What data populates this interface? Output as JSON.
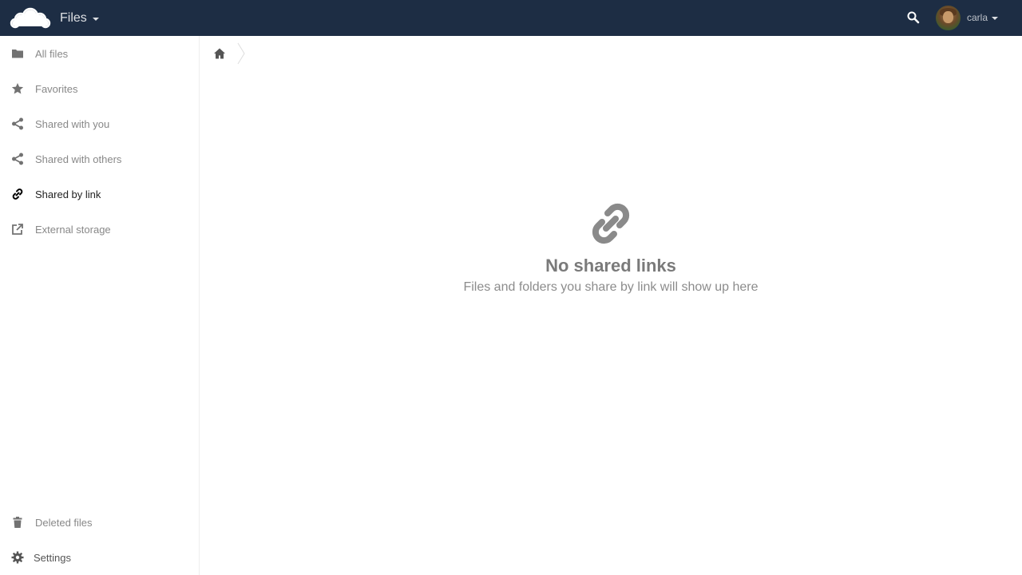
{
  "header": {
    "app_name": "Files",
    "user_name": "carla",
    "background_color": "#1d2d44"
  },
  "sidebar": {
    "items": [
      {
        "label": "All files",
        "icon": "folder-icon"
      },
      {
        "label": "Favorites",
        "icon": "star-icon"
      },
      {
        "label": "Shared with you",
        "icon": "share-icon"
      },
      {
        "label": "Shared with others",
        "icon": "share-icon"
      },
      {
        "label": "Shared by link",
        "icon": "link-icon",
        "active": true
      },
      {
        "label": "External storage",
        "icon": "external-storage-icon"
      }
    ],
    "deleted_files": {
      "label": "Deleted files",
      "icon": "trash-icon"
    },
    "settings": {
      "label": "Settings",
      "icon": "gear-icon"
    }
  },
  "breadcrumb": {
    "home_icon": "home-icon"
  },
  "empty_state": {
    "icon": "link-icon",
    "title": "No shared links",
    "hint": "Files and folders you share by link will show up here"
  }
}
